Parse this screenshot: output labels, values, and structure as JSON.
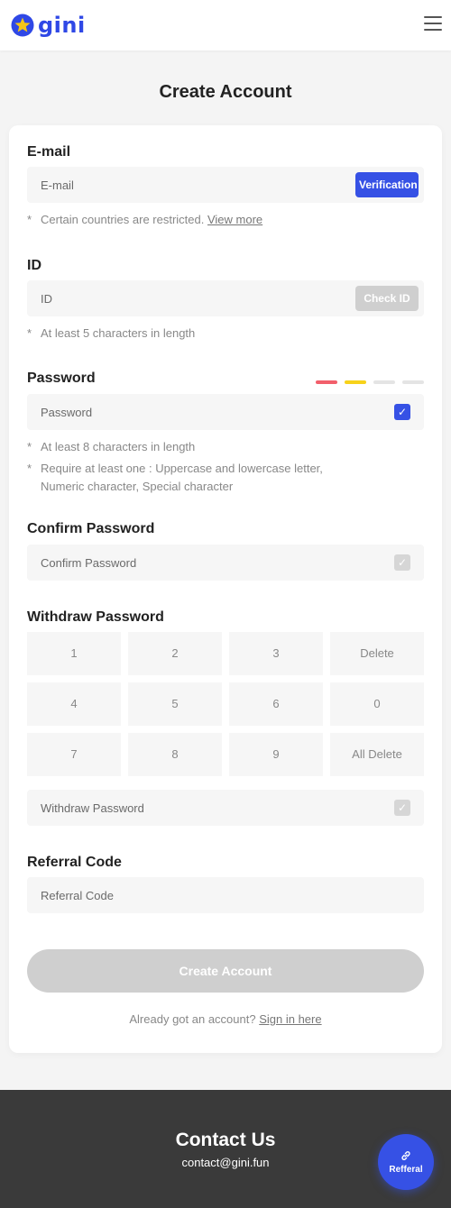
{
  "brand": {
    "name": "gini",
    "accent": "#3651e5",
    "star": "#f5c518"
  },
  "page": {
    "title": "Create Account"
  },
  "email": {
    "label": "E-mail",
    "placeholder": "E-mail",
    "button": "Verification",
    "note": "Certain countries are restricted.",
    "note_link": "View more"
  },
  "id": {
    "label": "ID",
    "placeholder": "ID",
    "button": "Check ID",
    "note": "At least 5 characters in length"
  },
  "password": {
    "label": "Password",
    "placeholder": "Password",
    "checked": true,
    "strength_colors": [
      "#f25f6b",
      "#f7d21a",
      "#e4e4e4",
      "#e4e4e4"
    ],
    "note1": "At least 8 characters in length",
    "note2_line1": "Require at least one : Uppercase and lowercase letter,",
    "note2_line2": "Numeric character, Special character"
  },
  "confirm": {
    "label": "Confirm Password",
    "placeholder": "Confirm Password",
    "checked": false
  },
  "withdraw": {
    "label": "Withdraw Password",
    "placeholder": "Withdraw Password",
    "checked": false,
    "keys": [
      "1",
      "2",
      "3",
      "Delete",
      "4",
      "5",
      "6",
      "0",
      "7",
      "8",
      "9",
      "All Delete"
    ]
  },
  "referral": {
    "label": "Referral Code",
    "placeholder": "Referral Code"
  },
  "submit": {
    "label": "Create Account"
  },
  "signin": {
    "text": "Already got an account?",
    "link": "Sign in here"
  },
  "footer": {
    "title": "Contact Us",
    "email": "contact@gini.fun"
  },
  "fab": {
    "label": "Refferal"
  },
  "check_mark": "✓"
}
